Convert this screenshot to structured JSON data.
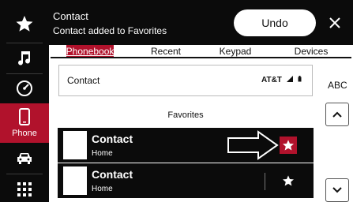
{
  "sidebar": {
    "items": [
      {
        "icon": "star-icon"
      },
      {
        "icon": "music-icon"
      },
      {
        "icon": "gauge-icon"
      },
      {
        "icon": "phone-icon",
        "label": "Phone"
      },
      {
        "icon": "car-icon"
      },
      {
        "icon": "apps-grid-icon"
      }
    ]
  },
  "banner": {
    "title": "Contact",
    "message": "Contact added to Favorites",
    "undo_label": "Undo",
    "close_icon": "close-icon"
  },
  "tabs": [
    "Phonebook",
    "Recent",
    "Keypad",
    "Devices"
  ],
  "contact_card": {
    "name": "Contact",
    "carrier": "AT&T"
  },
  "index_label": "ABC",
  "favorites": {
    "heading": "Favorites",
    "items": [
      {
        "name": "Contact",
        "type": "Home"
      },
      {
        "name": "Contact",
        "type": "Home"
      }
    ]
  },
  "colors": {
    "accent": "#b1122c",
    "dark": "#0b0b0b"
  }
}
